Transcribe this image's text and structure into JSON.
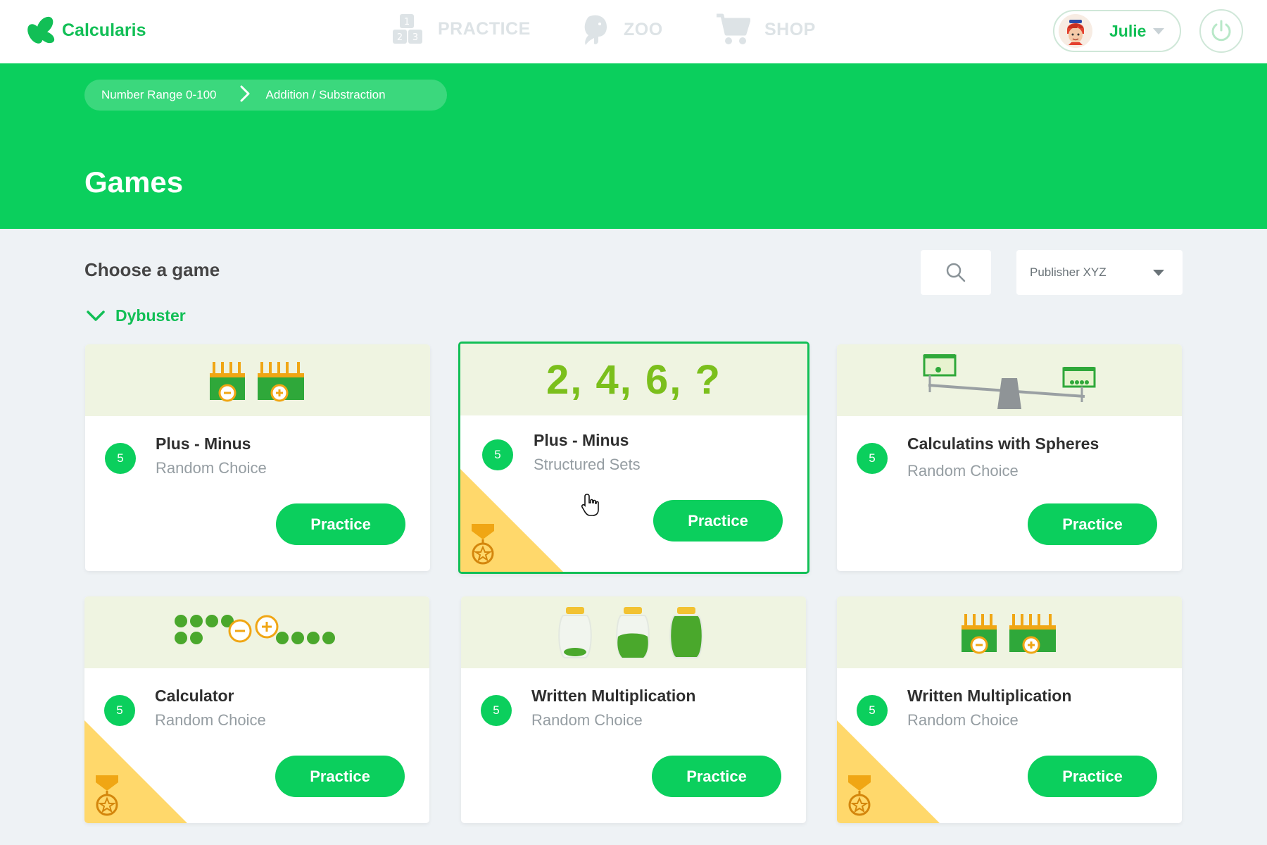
{
  "app": {
    "name": "Calcularis"
  },
  "nav": {
    "practice": "PRACTICE",
    "zoo": "ZOO",
    "shop": "SHOP"
  },
  "user": {
    "name": "Julie"
  },
  "breadcrumb": [
    "Number Range 0-100",
    "Addition / Substraction"
  ],
  "page": {
    "title": "Games"
  },
  "section": {
    "title": "Choose a game"
  },
  "filter": {
    "publisher": "Publisher XYZ"
  },
  "group": {
    "label": "Dybuster"
  },
  "colors": {
    "brand": "#0bcf5d",
    "text_green": "#12bf56",
    "card_top": "#eff4e1",
    "medal": "#ffd86b"
  },
  "cards": [
    {
      "level": "5",
      "title": "Plus - Minus",
      "subtitle": "Random Choice",
      "button": "Practice",
      "illustration": "abacus-minus-plus",
      "medal": false,
      "selected": false
    },
    {
      "level": "5",
      "title": "Plus - Minus",
      "subtitle": "Structured Sets",
      "button": "Practice",
      "illustration": "number-sequence",
      "sequence": "2, 4, 6, ?",
      "medal": true,
      "selected": true
    },
    {
      "level": "5",
      "title": "Calculatins with Spheres",
      "subtitle": "Random Choice",
      "button": "Practice",
      "illustration": "balance-scale",
      "medal": false,
      "selected": false
    },
    {
      "level": "5",
      "title": "Calculator",
      "subtitle": "Random Choice",
      "button": "Practice",
      "illustration": "bead-calculator",
      "medal": true,
      "selected": false
    },
    {
      "level": "5",
      "title": "Written Multiplication",
      "subtitle": "Random Choice",
      "button": "Practice",
      "illustration": "pea-jars",
      "medal": false,
      "selected": false
    },
    {
      "level": "5",
      "title": "Written Multiplication",
      "subtitle": "Random Choice",
      "button": "Practice",
      "illustration": "abacus-minus-plus",
      "medal": true,
      "selected": false
    }
  ]
}
